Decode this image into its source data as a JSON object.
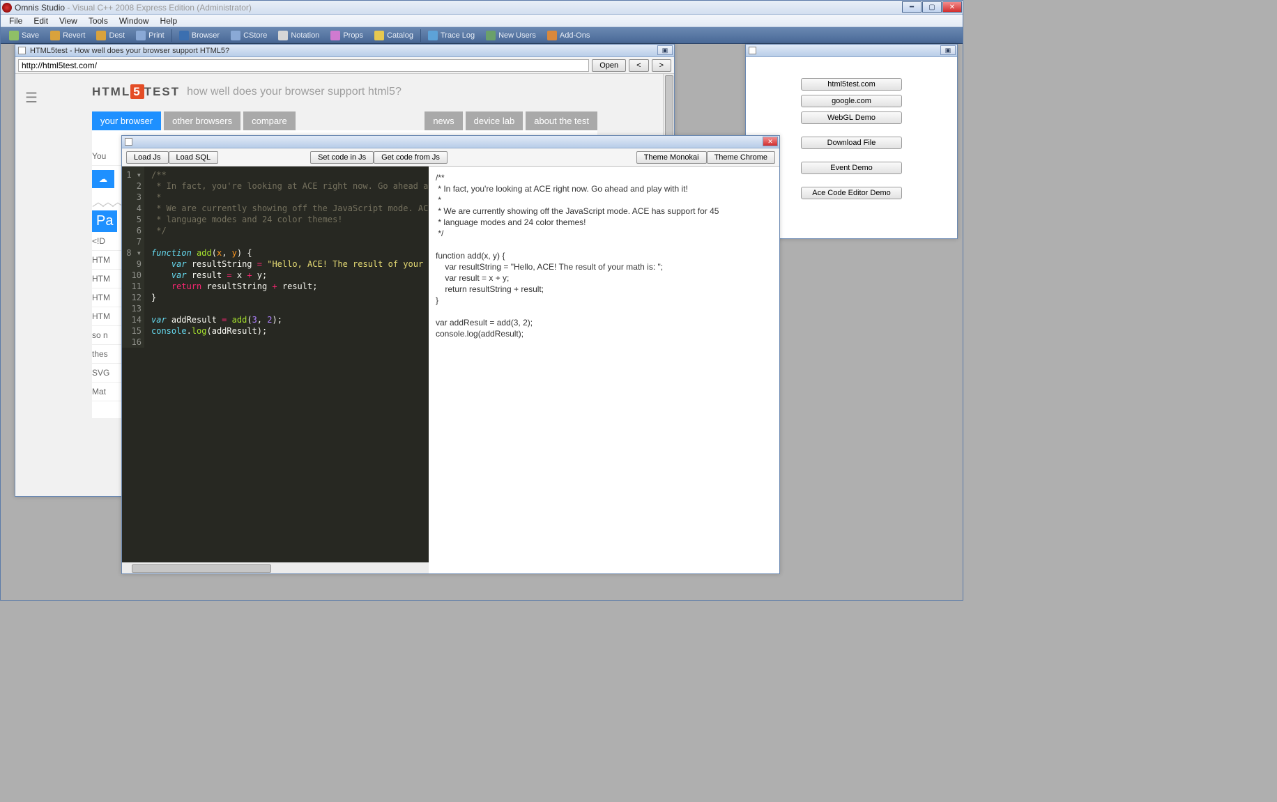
{
  "app": {
    "title_main": "Omnis Studio",
    "title_dim": "  - Visual C++ 2008 Express Edition (Administrator)"
  },
  "menu": [
    "File",
    "Edit",
    "View",
    "Tools",
    "Window",
    "Help"
  ],
  "toolbar": [
    {
      "label": "Save",
      "icon": "#8fbf66"
    },
    {
      "label": "Revert",
      "icon": "#d9a23c"
    },
    {
      "label": "Dest",
      "icon": "#d9a23c"
    },
    {
      "label": "Print",
      "icon": "#8aa9d6"
    },
    {
      "sep": true
    },
    {
      "label": "Browser",
      "icon": "#3b6fb0"
    },
    {
      "label": "CStore",
      "icon": "#8aa9d6"
    },
    {
      "label": "Notation",
      "icon": "#d6d6d6"
    },
    {
      "label": "Props",
      "icon": "#d07ad0"
    },
    {
      "label": "Catalog",
      "icon": "#e6c84f"
    },
    {
      "sep": true
    },
    {
      "label": "Trace Log",
      "icon": "#5da2d8"
    },
    {
      "label": "New Users",
      "icon": "#6aa06a"
    },
    {
      "label": "Add-Ons",
      "icon": "#d9883c"
    }
  ],
  "browser": {
    "title": "HTML5test - How well does your browser support HTML5?",
    "url": "http://html5test.com/",
    "buttons": {
      "open": "Open",
      "back": "<",
      "fwd": ">"
    },
    "page": {
      "logo_pre": "HTML",
      "logo_post": "TEST",
      "tagline": "how well does your browser support html5?",
      "tabs_left": [
        "your browser",
        "other browsers",
        "compare"
      ],
      "tabs_right": [
        "news",
        "device lab",
        "about the test"
      ],
      "left_items": [
        "You",
        "<!D",
        "HTM",
        "HTM",
        "HTM",
        "HTM",
        "so n",
        "thes",
        "SVG",
        "Mat"
      ],
      "pa": "Pa"
    }
  },
  "launcher": {
    "buttons": [
      "html5test.com",
      "google.com",
      "WebGL Demo",
      "Download File",
      "Event Demo",
      "Ace Code Editor Demo"
    ]
  },
  "editor": {
    "buttons_left": [
      "Load Js",
      "Load SQL"
    ],
    "buttons_mid": [
      "Set code in Js",
      "Get code from Js"
    ],
    "buttons_right": [
      "Theme Monokai",
      "Theme Chrome"
    ],
    "gutter": [
      "1",
      "2",
      "3",
      "4",
      "5",
      "6",
      "7",
      "8",
      "9",
      "10",
      "11",
      "12",
      "13",
      "14",
      "15",
      "16"
    ],
    "fold_lines": [
      1,
      8
    ],
    "code_tokens": [
      [
        {
          "t": "/**",
          "c": "cm-comment"
        }
      ],
      [
        {
          "t": " * In fact, you're looking at ACE right now. Go ahead and play with it!",
          "c": "cm-comment"
        }
      ],
      [
        {
          "t": " *",
          "c": "cm-comment"
        }
      ],
      [
        {
          "t": " * We are currently showing off the JavaScript mode. ACE has support for ",
          "c": "cm-comment"
        }
      ],
      [
        {
          "t": " * language modes and 24 color themes!",
          "c": "cm-comment"
        }
      ],
      [
        {
          "t": " */",
          "c": "cm-comment"
        }
      ],
      [
        {
          "t": "",
          "c": ""
        }
      ],
      [
        {
          "t": "function",
          "c": "cm-keyword"
        },
        {
          "t": " ",
          "c": ""
        },
        {
          "t": "add",
          "c": "cm-func"
        },
        {
          "t": "(",
          "c": ""
        },
        {
          "t": "x",
          "c": "cm-param"
        },
        {
          "t": ", ",
          "c": ""
        },
        {
          "t": "y",
          "c": "cm-param"
        },
        {
          "t": ") {",
          "c": ""
        }
      ],
      [
        {
          "t": "    ",
          "c": ""
        },
        {
          "t": "var",
          "c": "cm-decl"
        },
        {
          "t": " resultString ",
          "c": "cm-var"
        },
        {
          "t": "=",
          "c": "cm-op"
        },
        {
          "t": " ",
          "c": ""
        },
        {
          "t": "\"Hello, ACE! The result of your math is: \"",
          "c": "cm-string"
        },
        {
          "t": ";",
          "c": ""
        }
      ],
      [
        {
          "t": "    ",
          "c": ""
        },
        {
          "t": "var",
          "c": "cm-decl"
        },
        {
          "t": " result ",
          "c": "cm-var"
        },
        {
          "t": "=",
          "c": "cm-op"
        },
        {
          "t": " x ",
          "c": "cm-var"
        },
        {
          "t": "+",
          "c": "cm-op"
        },
        {
          "t": " y;",
          "c": "cm-var"
        }
      ],
      [
        {
          "t": "    ",
          "c": ""
        },
        {
          "t": "return",
          "c": "cm-return"
        },
        {
          "t": " resultString ",
          "c": "cm-var"
        },
        {
          "t": "+",
          "c": "cm-op"
        },
        {
          "t": " result;",
          "c": "cm-var"
        }
      ],
      [
        {
          "t": "}",
          "c": ""
        }
      ],
      [
        {
          "t": "",
          "c": ""
        }
      ],
      [
        {
          "t": "var",
          "c": "cm-decl"
        },
        {
          "t": " addResult ",
          "c": "cm-var"
        },
        {
          "t": "=",
          "c": "cm-op"
        },
        {
          "t": " ",
          "c": ""
        },
        {
          "t": "add",
          "c": "cm-func"
        },
        {
          "t": "(",
          "c": ""
        },
        {
          "t": "3",
          "c": "cm-num"
        },
        {
          "t": ", ",
          "c": ""
        },
        {
          "t": "2",
          "c": "cm-num"
        },
        {
          "t": ");",
          "c": ""
        }
      ],
      [
        {
          "t": "console",
          "c": "cm-obj"
        },
        {
          "t": ".",
          "c": ""
        },
        {
          "t": "log",
          "c": "cm-func"
        },
        {
          "t": "(addResult);",
          "c": "cm-var"
        }
      ],
      [
        {
          "t": "",
          "c": ""
        }
      ]
    ],
    "plain_text": "/**\n * In fact, you're looking at ACE right now. Go ahead and play with it!\n *\n * We are currently showing off the JavaScript mode. ACE has support for 45\n * language modes and 24 color themes!\n */\n\nfunction add(x, y) {\n    var resultString = \"Hello, ACE! The result of your math is: \";\n    var result = x + y;\n    return resultString + result;\n}\n\nvar addResult = add(3, 2);\nconsole.log(addResult);"
  }
}
